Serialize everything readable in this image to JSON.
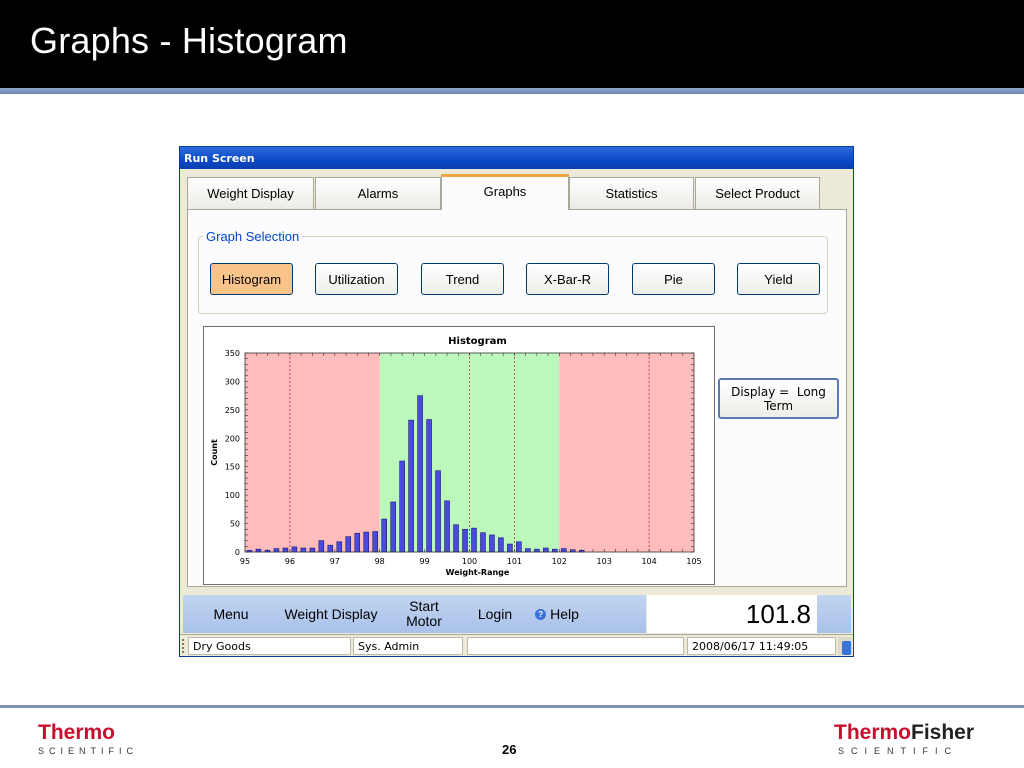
{
  "slide": {
    "title": "Graphs - Histogram",
    "page_number": "26",
    "logo_left": {
      "brand": "Thermo",
      "sub": "SCIENTIFIC"
    },
    "logo_right": {
      "brand_red": "Thermo",
      "brand_dark": "Fisher",
      "sub": "SCIENTIFIC"
    }
  },
  "window": {
    "title": "Run Screen",
    "tabs": [
      {
        "label": "Weight Display",
        "active": false
      },
      {
        "label": "Alarms",
        "active": false
      },
      {
        "label": "Graphs",
        "active": true
      },
      {
        "label": "Statistics",
        "active": false
      },
      {
        "label": "Select Product",
        "active": false
      }
    ],
    "graph_selection": {
      "label": "Graph Selection",
      "buttons": [
        "Histogram",
        "Utilization",
        "Trend",
        "X-Bar-R",
        "Pie",
        "Yield"
      ],
      "selected": "Histogram"
    },
    "display_button": "Display =  Long Term",
    "menubar": {
      "menu": "Menu",
      "weight_display": "Weight Display",
      "start_motor": "Start Motor",
      "login": "Login",
      "help": "Help"
    },
    "readout": "101.8",
    "status": {
      "product": "Dry Goods",
      "user": "Sys. Admin",
      "field": "",
      "datetime": "2008/06/17 11:49:05"
    }
  },
  "colors": {
    "reject_zone": "#ffbcbc",
    "accept_zone": "#bcf7bc",
    "bar_fill": "#4a4ae0",
    "active_button": "#f9c48a"
  },
  "chart_data": {
    "type": "bar",
    "title": "Histogram",
    "xlabel": "Weight-Range",
    "ylabel": "Count",
    "xlim": [
      95,
      105
    ],
    "ylim": [
      0,
      350
    ],
    "x_ticks": [
      95,
      96,
      97,
      98,
      99,
      100,
      101,
      102,
      103,
      104,
      105
    ],
    "y_ticks": [
      0,
      50,
      100,
      150,
      200,
      250,
      300,
      350
    ],
    "grid": false,
    "zones": [
      {
        "from": 95,
        "to": 98,
        "kind": "reject"
      },
      {
        "from": 98,
        "to": 102,
        "kind": "accept"
      },
      {
        "from": 102,
        "to": 105,
        "kind": "reject"
      }
    ],
    "dotted_reference_lines": [
      96,
      100,
      101,
      104
    ],
    "bars": [
      {
        "x": 95.1,
        "y": 3
      },
      {
        "x": 95.3,
        "y": 5
      },
      {
        "x": 95.5,
        "y": 3
      },
      {
        "x": 95.7,
        "y": 6
      },
      {
        "x": 95.9,
        "y": 7
      },
      {
        "x": 96.1,
        "y": 9
      },
      {
        "x": 96.3,
        "y": 7
      },
      {
        "x": 96.5,
        "y": 7
      },
      {
        "x": 96.7,
        "y": 20
      },
      {
        "x": 96.9,
        "y": 12
      },
      {
        "x": 97.1,
        "y": 18
      },
      {
        "x": 97.3,
        "y": 27
      },
      {
        "x": 97.5,
        "y": 33
      },
      {
        "x": 97.7,
        "y": 35
      },
      {
        "x": 97.9,
        "y": 36
      },
      {
        "x": 98.1,
        "y": 58
      },
      {
        "x": 98.3,
        "y": 88
      },
      {
        "x": 98.5,
        "y": 160
      },
      {
        "x": 98.7,
        "y": 232
      },
      {
        "x": 98.9,
        "y": 275
      },
      {
        "x": 99.1,
        "y": 233
      },
      {
        "x": 99.3,
        "y": 143
      },
      {
        "x": 99.5,
        "y": 90
      },
      {
        "x": 99.7,
        "y": 48
      },
      {
        "x": 99.9,
        "y": 40
      },
      {
        "x": 100.1,
        "y": 42
      },
      {
        "x": 100.3,
        "y": 34
      },
      {
        "x": 100.5,
        "y": 30
      },
      {
        "x": 100.7,
        "y": 25
      },
      {
        "x": 100.9,
        "y": 14
      },
      {
        "x": 101.1,
        "y": 18
      },
      {
        "x": 101.3,
        "y": 6
      },
      {
        "x": 101.5,
        "y": 5
      },
      {
        "x": 101.7,
        "y": 7
      },
      {
        "x": 101.9,
        "y": 5
      },
      {
        "x": 102.1,
        "y": 6
      },
      {
        "x": 102.3,
        "y": 4
      },
      {
        "x": 102.5,
        "y": 3
      }
    ]
  }
}
